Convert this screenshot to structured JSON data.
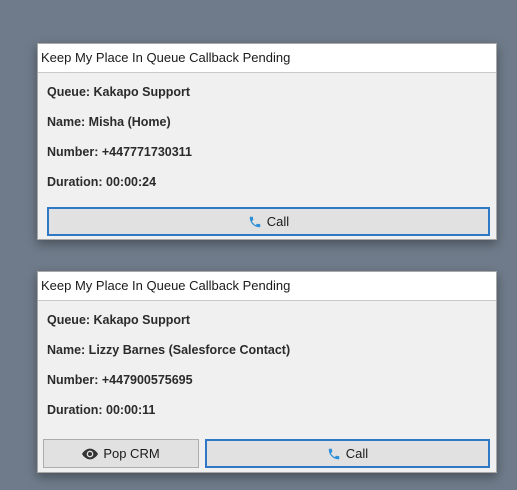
{
  "cards": [
    {
      "title": "Keep My Place In Queue Callback Pending",
      "queue": "Queue: Kakapo Support",
      "name": "Name: Misha (Home)",
      "number": "Number: +447771730311",
      "duration": "Duration: 00:00:24",
      "call_label": "Call"
    },
    {
      "title": "Keep My Place In Queue Callback Pending",
      "queue": "Queue: Kakapo Support",
      "name": "Name: Lizzy Barnes (Salesforce Contact)",
      "number": "Number: +447900575695",
      "duration": "Duration: 00:00:11",
      "pop_crm_label": "Pop CRM",
      "call_label": "Call"
    }
  ],
  "icons": {
    "call": "phone-icon",
    "pop_crm": "eye-icon"
  },
  "colors": {
    "accent": "#2f78c6",
    "phone_icon": "#2d8fd9",
    "background": "#6f7b8a"
  }
}
